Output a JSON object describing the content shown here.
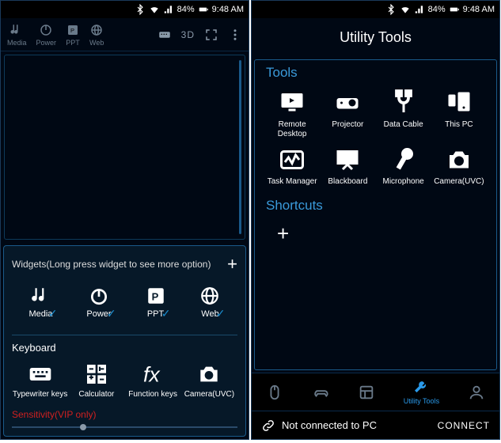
{
  "status": {
    "battery_pct": "84%",
    "time": "9:48 AM"
  },
  "left": {
    "topbar": {
      "media": "Media",
      "power": "Power",
      "ppt": "PPT",
      "web": "Web",
      "d3": "3D"
    },
    "widgets_title": "Widgets(Long press widget to see more option)",
    "widgets": {
      "media": "Media",
      "power": "Power",
      "ppt": "PPT",
      "web": "Web"
    },
    "keyboard_title": "Keyboard",
    "keys": {
      "typewriter": "Typewriter keys",
      "calc": "Calculator",
      "fn": "Function keys",
      "cam": "Camera(UVC)"
    },
    "sensitivity": "Sensitivity(VIP only)"
  },
  "right": {
    "title": "Utility Tools",
    "tools_hdr": "Tools",
    "tools": {
      "remote": "Remote Desktop",
      "projector": "Projector",
      "cable": "Data Cable",
      "thispc": "This PC",
      "task": "Task Manager",
      "black": "Blackboard",
      "mic": "Microphone",
      "cam": "Camera(UVC)"
    },
    "shortcuts_hdr": "Shortcuts",
    "nav": {
      "utility": "Utility Tools"
    },
    "conn_status": "Not connected to PC",
    "connect": "CONNECT"
  }
}
